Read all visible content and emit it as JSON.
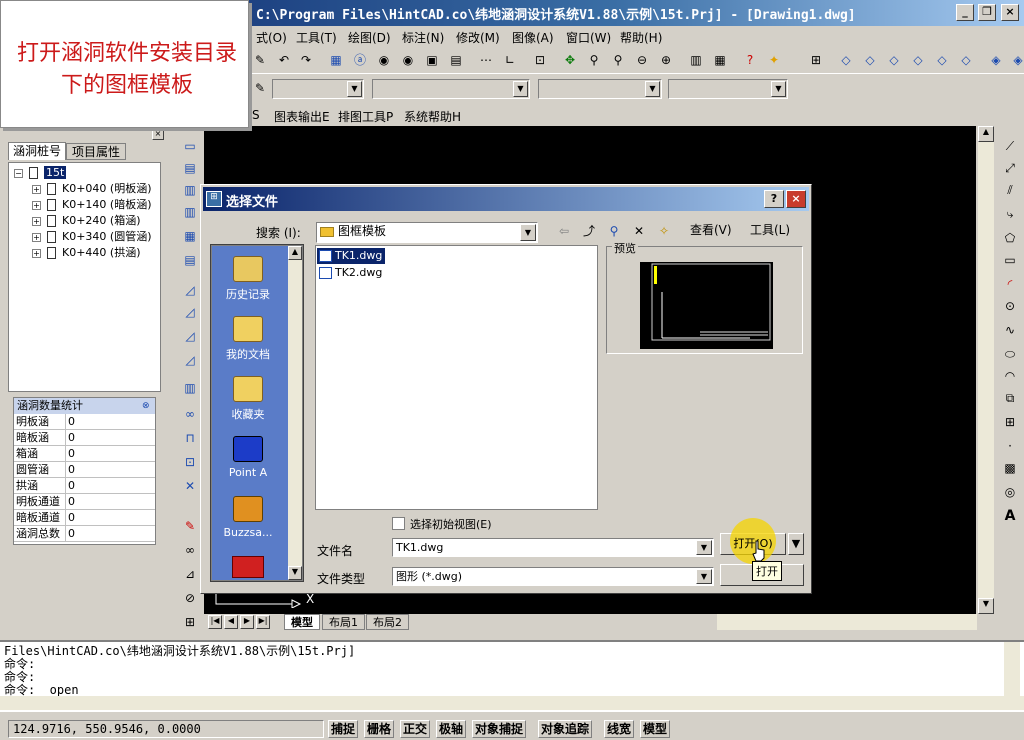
{
  "app": {
    "title": "C:\\Program Files\\HintCAD.co\\纬地涵洞设计系统V1.88\\示例\\15t.Prj] - [Drawing1.dwg]"
  },
  "overlay_note": {
    "text": "打开涵洞软件安装目录下的图框模板"
  },
  "menu": {
    "items": [
      "式(O)",
      "工具(T)",
      "绘图(D)",
      "标注(N)",
      "修改(M)",
      "图像(A)",
      "窗口(W)",
      "帮助(H)"
    ]
  },
  "submenu": {
    "items": [
      "S",
      "图表输出E",
      "排图工具P",
      "系统帮助H"
    ]
  },
  "panel": {
    "tabs": [
      "涵洞桩号",
      "项目属性"
    ],
    "root": "15t",
    "tree_items": [
      "K0+040 (明板涵)",
      "K0+140 (暗板涵)",
      "K0+240 (箱涵)",
      "K0+340 (圆管涵)",
      "K0+440 (拱涵)"
    ],
    "stats_header": "涵洞数量统计",
    "stats": [
      {
        "k": "明板涵",
        "v": "0"
      },
      {
        "k": "暗板涵",
        "v": "0"
      },
      {
        "k": "箱涵",
        "v": "0"
      },
      {
        "k": "圆管涵",
        "v": "0"
      },
      {
        "k": "拱涵",
        "v": "0"
      },
      {
        "k": "明板通道",
        "v": "0"
      },
      {
        "k": "暗板通道",
        "v": "0"
      },
      {
        "k": "涵洞总数",
        "v": "0"
      }
    ]
  },
  "dialog": {
    "title": "选择文件",
    "search_label": "搜索 (I):",
    "folder": "图框模板",
    "view_label": "查看(V)",
    "tools_label": "工具(L)",
    "preview_label": "预览",
    "places": [
      "历史记录",
      "我的文档",
      "收藏夹",
      "Point A",
      "Buzzsa..."
    ],
    "files": [
      "TK1.dwg",
      "TK2.dwg"
    ],
    "initial_view_label": "选择初始视图(E)",
    "filename_label": "文件名",
    "filename_value": "TK1.dwg",
    "filetype_label": "文件类型",
    "filetype_value": "图形 (*.dwg)",
    "open_button": "打开(O)",
    "tooltip": "打开"
  },
  "layout_tabs": [
    "模型",
    "布局1",
    "布局2"
  ],
  "command": {
    "lines": [
      "Files\\HintCAD.co\\纬地涵洞设计系统V1.88\\示例\\15t.Prj]",
      "命令:",
      "命令:",
      "命令: _open"
    ]
  },
  "status": {
    "coords": "124.9716, 550.9546, 0.0000",
    "toggles": [
      "捕捉",
      "栅格",
      "正交",
      "极轴",
      "对象捕捉",
      "对象追踪",
      "线宽",
      "模型"
    ]
  },
  "ucs_axis_label": "X",
  "colors": {
    "title_blue": "#0a246a",
    "note_red": "#cc1a1a",
    "open_highlight": "#f5d400"
  }
}
